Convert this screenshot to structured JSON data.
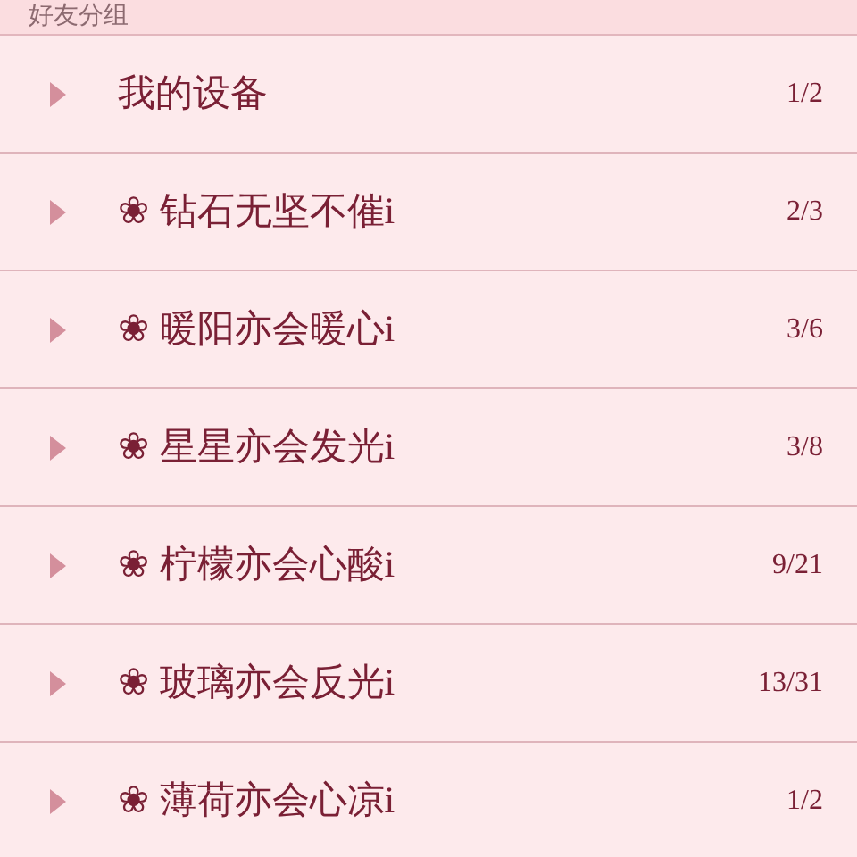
{
  "header": {
    "title": "好友分组"
  },
  "groups": [
    {
      "name": "我的设备",
      "count": "1/2"
    },
    {
      "name": "❀ 钻石无坚不催i",
      "count": "2/3"
    },
    {
      "name": "❀ 暖阳亦会暖心i",
      "count": "3/6"
    },
    {
      "name": "❀ 星星亦会发光i",
      "count": "3/8"
    },
    {
      "name": "❀ 柠檬亦会心酸i",
      "count": "9/21"
    },
    {
      "name": "❀ 玻璃亦会反光i",
      "count": "13/31"
    },
    {
      "name": "❀ 薄荷亦会心凉i",
      "count": "1/2"
    }
  ]
}
